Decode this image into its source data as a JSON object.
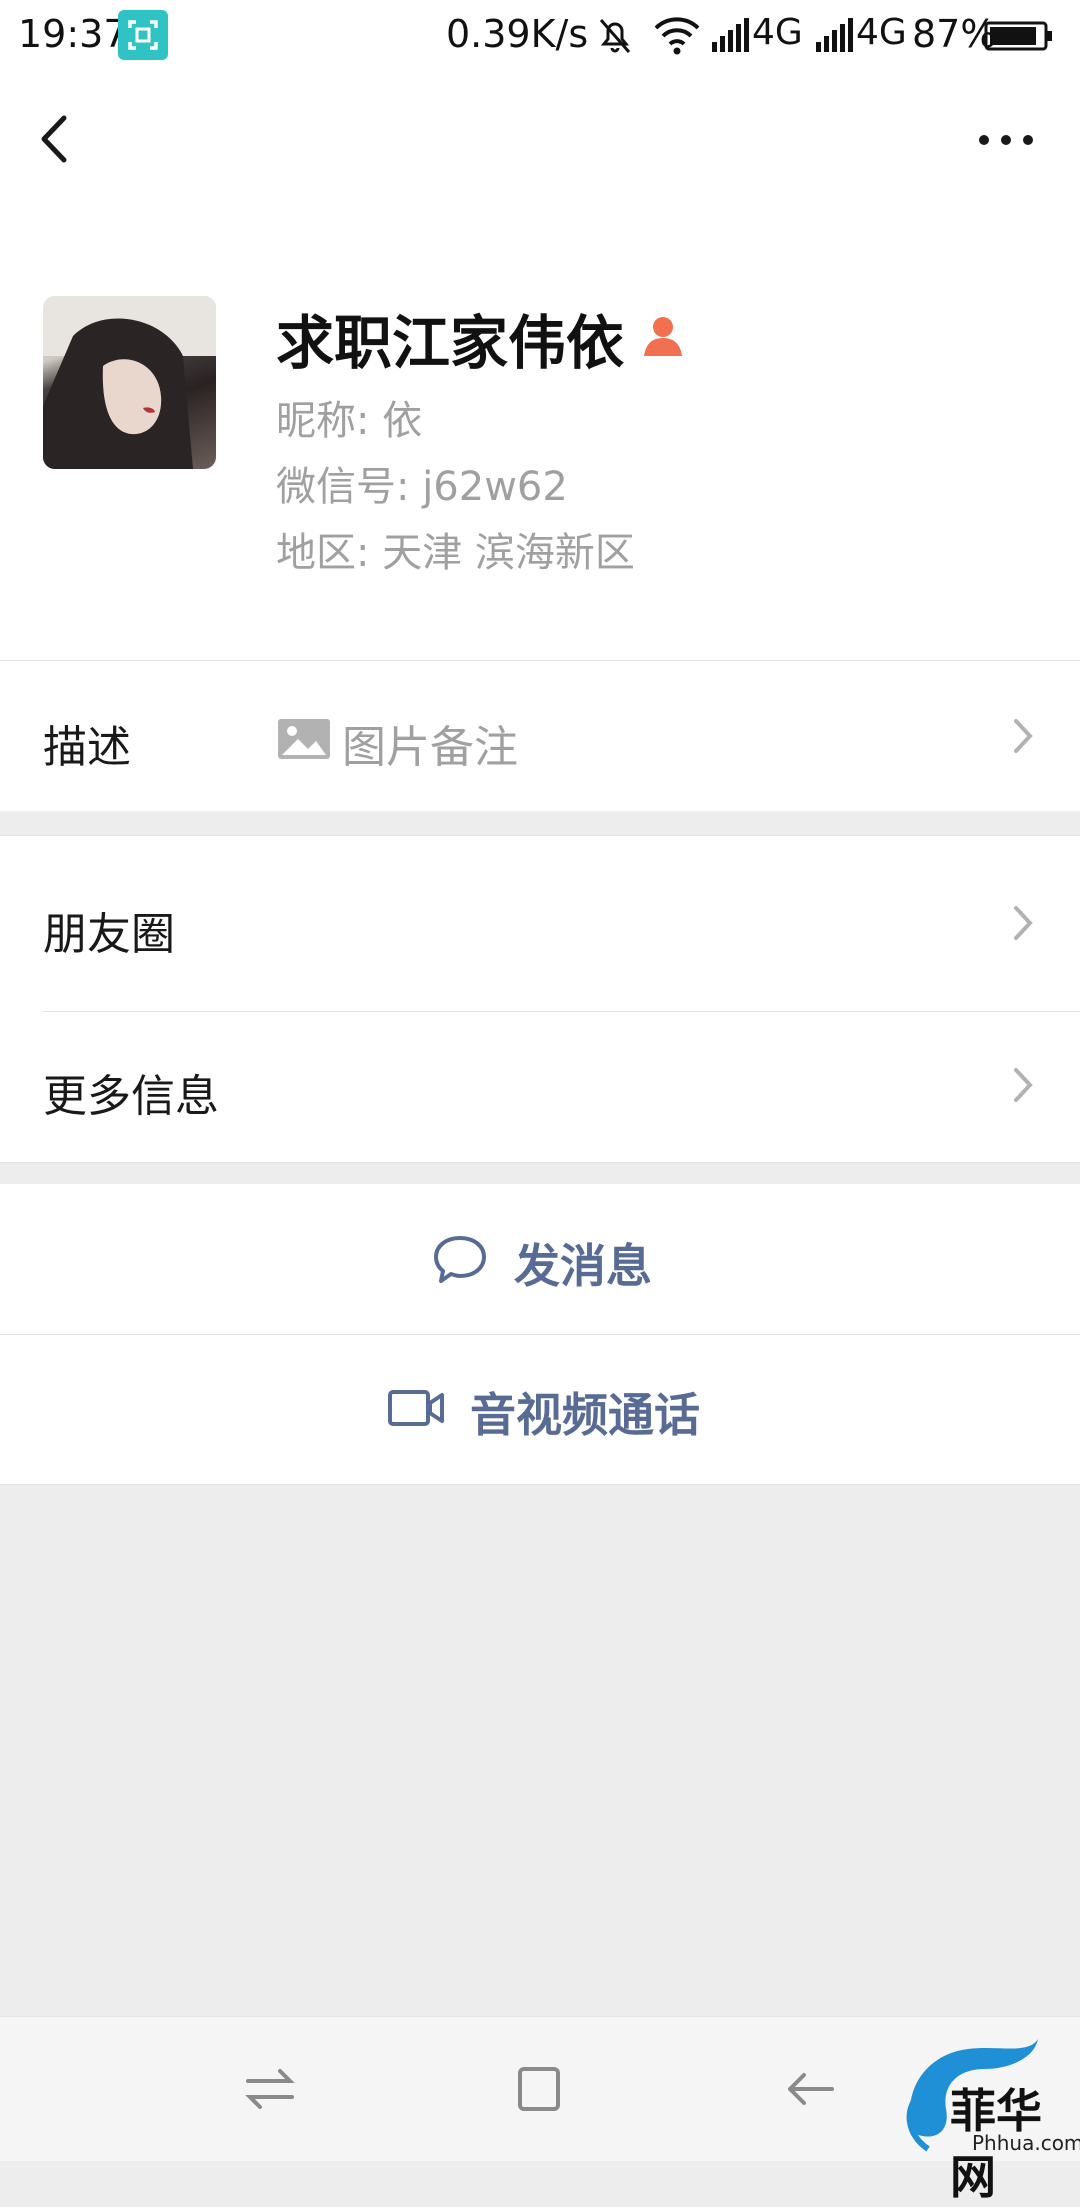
{
  "status_bar": {
    "time": "19:37",
    "network_speed": "0.39K/s",
    "signal_1": "4G",
    "signal_2": "4G",
    "battery_percent": "87%"
  },
  "profile": {
    "display_name": "求职江家伟依",
    "nickname": "昵称:  依",
    "wechat_id": "微信号:  j62w62",
    "region": "地区:  天津  滨海新区"
  },
  "rows": {
    "description_label": "描述",
    "description_value": "图片备注",
    "moments_label": "朋友圈",
    "more_info_label": "更多信息"
  },
  "actions": {
    "send_message": "发消息",
    "video_call": "音视频通话"
  },
  "watermark": {
    "text": "菲华网",
    "sub": "Phhua.com"
  },
  "colors": {
    "accent": "#576b95",
    "gender_icon": "#f07050",
    "scan_badge": "#2fc3c3"
  }
}
